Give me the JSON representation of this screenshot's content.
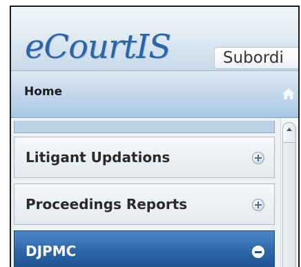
{
  "app": {
    "title": "eCourtIS",
    "subtitle": "Subordi"
  },
  "nav": {
    "home_label": "Home",
    "home_icon": "home-icon"
  },
  "accordion": {
    "items": [
      {
        "label": "Litigant Updations",
        "icon": "plus-circle-icon",
        "state": "collapsed"
      },
      {
        "label": "Proceedings Reports",
        "icon": "plus-circle-icon",
        "state": "collapsed"
      },
      {
        "label": "DJPMC",
        "icon": "minus-circle-icon",
        "state": "expanded"
      }
    ]
  },
  "colors": {
    "brand_title": "#2d63a7",
    "active_header": "#2d66a8",
    "home_bar": "#c1d6ea"
  }
}
